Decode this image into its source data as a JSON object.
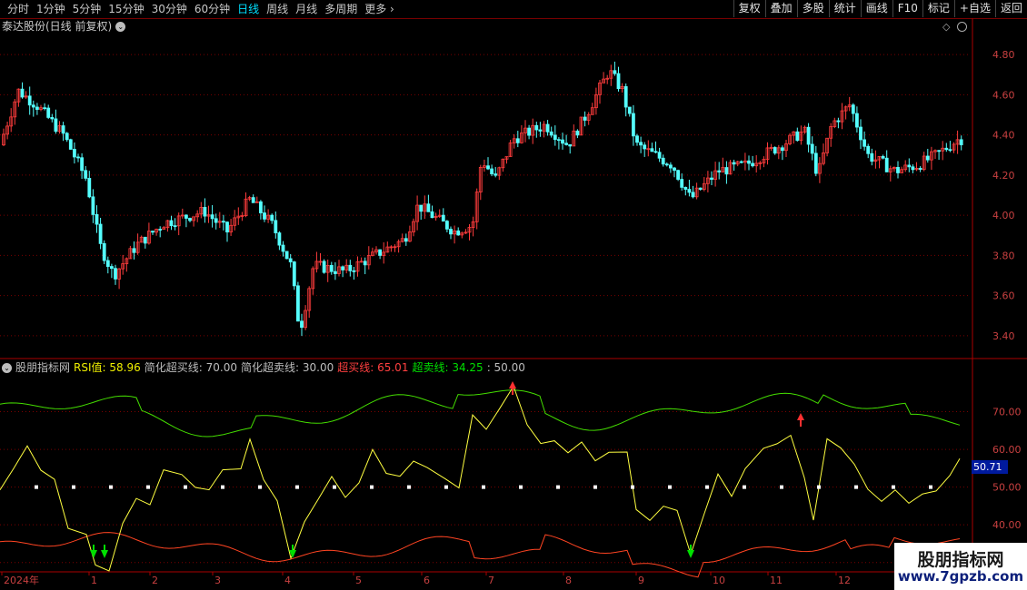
{
  "toolbar": {
    "periods": [
      "分时",
      "1分钟",
      "5分钟",
      "15分钟",
      "30分钟",
      "60分钟",
      "日线",
      "周线",
      "月线",
      "多周期",
      "更多"
    ],
    "active_period": "日线",
    "buttons": [
      "复权",
      "叠加",
      "多股",
      "统计",
      "画线",
      "F10",
      "标记",
      "+自选",
      "返回"
    ]
  },
  "main": {
    "title": "泰达股份(日线 前复权)",
    "price_axis": [
      "4.80",
      "4.60",
      "4.40",
      "4.20",
      "4.00",
      "3.80",
      "3.60",
      "3.40"
    ]
  },
  "indicator": {
    "name": "股朋指标网",
    "rsi_label": "RSI值:",
    "rsi_value": "58.96",
    "simp_ob_label": "简化超买线:",
    "simp_ob_value": "70.00",
    "simp_os_label": "简化超卖线:",
    "simp_os_value": "30.00",
    "ob_label": "超买线:",
    "ob_value": "65.01",
    "os_label": "超卖线:",
    "os_value": "34.25",
    "mid_value": ": 50.00",
    "axis": [
      "70.00",
      "60.00",
      "50.00",
      "40.00"
    ],
    "current_tag": "50.71"
  },
  "time_axis": [
    "2024年",
    "1",
    "2",
    "3",
    "4",
    "5",
    "6",
    "7",
    "8",
    "9",
    "10",
    "11",
    "12"
  ],
  "watermark": {
    "title": "股朋指标网",
    "url": "www.7gpzb.com"
  },
  "chart_data": {
    "type": "line",
    "price_range": [
      3.3,
      4.9
    ],
    "indicator_range": [
      28,
      80
    ],
    "up_color": "#ff3c3c",
    "down_color": "#54ffff",
    "rsi_color": "#ffff40",
    "upper_band_color": "#44dd00",
    "lower_band_color": "#ff4422"
  }
}
